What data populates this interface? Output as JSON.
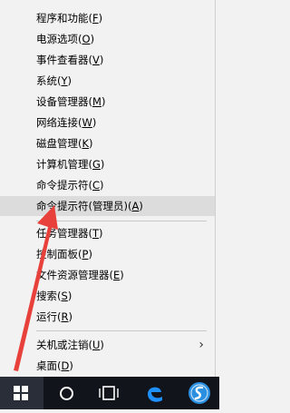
{
  "menu": {
    "items": [
      {
        "label": "程序和功能",
        "key": "F"
      },
      {
        "label": "电源选项",
        "key": "O"
      },
      {
        "label": "事件查看器",
        "key": "V"
      },
      {
        "label": "系统",
        "key": "Y"
      },
      {
        "label": "设备管理器",
        "key": "M"
      },
      {
        "label": "网络连接",
        "key": "W"
      },
      {
        "label": "磁盘管理",
        "key": "K"
      },
      {
        "label": "计算机管理",
        "key": "G"
      },
      {
        "label": "命令提示符",
        "key": "C"
      },
      {
        "label": "命令提示符(管理员)",
        "key": "A"
      },
      {
        "label": "任务管理器",
        "key": "T"
      },
      {
        "label": "控制面板",
        "key": "P"
      },
      {
        "label": "文件资源管理器",
        "key": "E"
      },
      {
        "label": "搜索",
        "key": "S"
      },
      {
        "label": "运行",
        "key": "R"
      },
      {
        "label": "关机或注销",
        "key": "U"
      },
      {
        "label": "桌面",
        "key": "D"
      }
    ],
    "highlighted_item": "命令提示符(管理员)",
    "submenu_arrow": "›"
  },
  "taskbar": {
    "icons": [
      "windows-icon",
      "search-circle-icon",
      "task-view-icon",
      "edge-icon",
      "browser-icon"
    ],
    "colors": {
      "background": "#11141b",
      "start_hover": "#2a2e38",
      "edge_blue": "#1e90ff",
      "browser_blue": "#2b8fe0"
    }
  },
  "annotation": {
    "arrow_color": "#e8413b"
  }
}
